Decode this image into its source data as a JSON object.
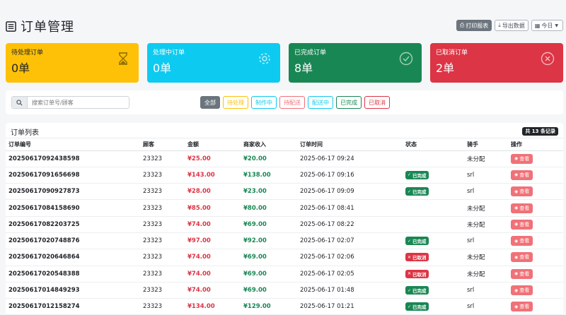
{
  "header": {
    "title": "订单管理",
    "print_label": "打印报表",
    "export_label": "导出数据",
    "date_label": "今日"
  },
  "stats": [
    {
      "label": "待处理订单",
      "value": "0单",
      "icon": "hourglass-icon",
      "color": "#ffc107"
    },
    {
      "label": "处理中订单",
      "value": "0单",
      "icon": "gear-icon",
      "color": "#0dcaf0"
    },
    {
      "label": "已完成订单",
      "value": "8单",
      "icon": "check-circle-icon",
      "color": "#198754"
    },
    {
      "label": "已取消订单",
      "value": "2单",
      "icon": "x-circle-icon",
      "color": "#dc3545"
    }
  ],
  "search": {
    "placeholder": "搜索订单号/顾客"
  },
  "filters": [
    {
      "label": "全部",
      "color": "#6c757d",
      "active": true
    },
    {
      "label": "待处理",
      "color": "#ffc107",
      "active": false
    },
    {
      "label": "制作中",
      "color": "#0dcaf0",
      "active": false
    },
    {
      "label": "待配送",
      "color": "#f07178",
      "active": false
    },
    {
      "label": "配送中",
      "color": "#0dcaf0",
      "active": false
    },
    {
      "label": "已完成",
      "color": "#198754",
      "active": false
    },
    {
      "label": "已取消",
      "color": "#dc3545",
      "active": false
    }
  ],
  "list": {
    "title": "订单列表",
    "total": "共 13 条记录",
    "columns": [
      "订单编号",
      "顾客",
      "金额",
      "商家收入",
      "订单时间",
      "状态",
      "骑手",
      "操作"
    ],
    "view_label": "查看",
    "rows": [
      {
        "order_no": "20250617092438598",
        "customer": "23323",
        "amount": "¥25.00",
        "income": "¥20.00",
        "time": "2025-06-17 09:24",
        "status": "",
        "status_type": "",
        "rider": "未分配"
      },
      {
        "order_no": "20250617091656698",
        "customer": "23323",
        "amount": "¥143.00",
        "income": "¥138.00",
        "time": "2025-06-17 09:16",
        "status": "已完成",
        "status_type": "done",
        "rider": "srl"
      },
      {
        "order_no": "20250617090927873",
        "customer": "23323",
        "amount": "¥28.00",
        "income": "¥23.00",
        "time": "2025-06-17 09:09",
        "status": "已完成",
        "status_type": "done",
        "rider": "srl"
      },
      {
        "order_no": "20250617084158690",
        "customer": "23323",
        "amount": "¥85.00",
        "income": "¥80.00",
        "time": "2025-06-17 08:41",
        "status": "",
        "status_type": "",
        "rider": "未分配"
      },
      {
        "order_no": "20250617082203725",
        "customer": "23323",
        "amount": "¥74.00",
        "income": "¥69.00",
        "time": "2025-06-17 08:22",
        "status": "",
        "status_type": "",
        "rider": "未分配"
      },
      {
        "order_no": "20250617020748876",
        "customer": "23323",
        "amount": "¥97.00",
        "income": "¥92.00",
        "time": "2025-06-17 02:07",
        "status": "已完成",
        "status_type": "done",
        "rider": "srl"
      },
      {
        "order_no": "20250617020646864",
        "customer": "23323",
        "amount": "¥74.00",
        "income": "¥69.00",
        "time": "2025-06-17 02:06",
        "status": "已取消",
        "status_type": "cancel",
        "rider": "未分配"
      },
      {
        "order_no": "20250617020548388",
        "customer": "23323",
        "amount": "¥74.00",
        "income": "¥69.00",
        "time": "2025-06-17 02:05",
        "status": "已取消",
        "status_type": "cancel",
        "rider": "未分配"
      },
      {
        "order_no": "20250617014849293",
        "customer": "23323",
        "amount": "¥74.00",
        "income": "¥69.00",
        "time": "2025-06-17 01:48",
        "status": "已完成",
        "status_type": "done",
        "rider": "srl"
      },
      {
        "order_no": "20250617012158274",
        "customer": "23323",
        "amount": "¥134.00",
        "income": "¥129.00",
        "time": "2025-06-17 01:21",
        "status": "已完成",
        "status_type": "done",
        "rider": "srl"
      }
    ]
  }
}
